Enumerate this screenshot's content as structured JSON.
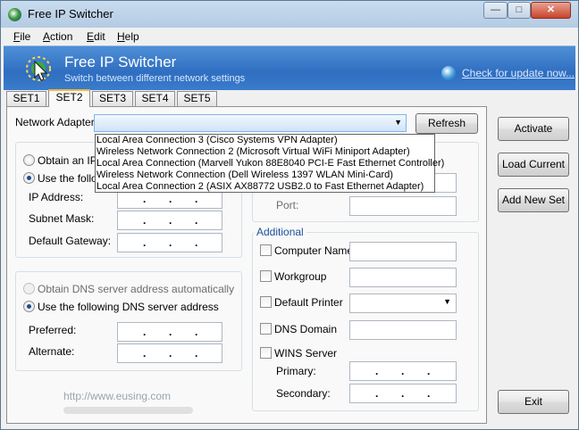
{
  "window": {
    "title": "Free IP Switcher",
    "minimize": "—",
    "maximize": "□",
    "close": "✕",
    "app_icon": "ip-switcher-icon"
  },
  "menu": [
    {
      "key": "F",
      "rest": "ile"
    },
    {
      "key": "A",
      "rest": "ction"
    },
    {
      "key": "E",
      "rest": "dit"
    },
    {
      "key": "H",
      "rest": "elp"
    }
  ],
  "banner": {
    "title": "Free IP Switcher",
    "subtitle": "Switch between different network settings",
    "update_link": "Check for update now...",
    "colors": {
      "top": "#4f8fd6",
      "bottom": "#2f6ec0"
    }
  },
  "tabs": [
    "SET1",
    "SET2",
    "SET3",
    "SET4",
    "SET5"
  ],
  "active_tab": "SET2",
  "adapter": {
    "label": "Network Adapter:",
    "value": "",
    "refresh": "Refresh"
  },
  "adapter_options": [
    "Local Area Connection 3  (Cisco Systems VPN Adapter)",
    "Wireless Network Connection 2  (Microsoft Virtual WiFi Miniport Adapter)",
    "Local Area Connection  (Marvell Yukon 88E8040 PCI-E Fast Ethernet Controller)",
    "Wireless Network Connection  (Dell Wireless 1397 WLAN Mini-Card)",
    "Local Area Connection 2  (ASIX AX88772 USB2.0 to Fast Ethernet Adapter)"
  ],
  "ip": {
    "obtain_auto": "Obtain an IP",
    "use_following": "Use the follo",
    "selected": "use_following",
    "ip_address": "IP Address:",
    "subnet_mask": "Subnet Mask:",
    "gateway": "Default Gateway:",
    "dots": [
      ".",
      ".",
      "."
    ]
  },
  "dns": {
    "obtain_auto": "Obtain DNS server address automatically",
    "use_following": "Use the following DNS server address",
    "selected": "use_following",
    "preferred": "Preferred:",
    "alternate": "Alternate:"
  },
  "proxy": {
    "port": "Port:"
  },
  "additional": {
    "title": "Additional",
    "computer_name": "Computer Name",
    "workgroup": "Workgroup",
    "default_printer": "Default Printer",
    "dns_domain": "DNS Domain",
    "wins_server": "WINS Server",
    "primary": "Primary:",
    "secondary": "Secondary:"
  },
  "actions": {
    "activate": "Activate",
    "load_current": "Load Current",
    "add_new_set": "Add New Set",
    "exit": "Exit"
  },
  "watermark": "http://www.eusing.com"
}
